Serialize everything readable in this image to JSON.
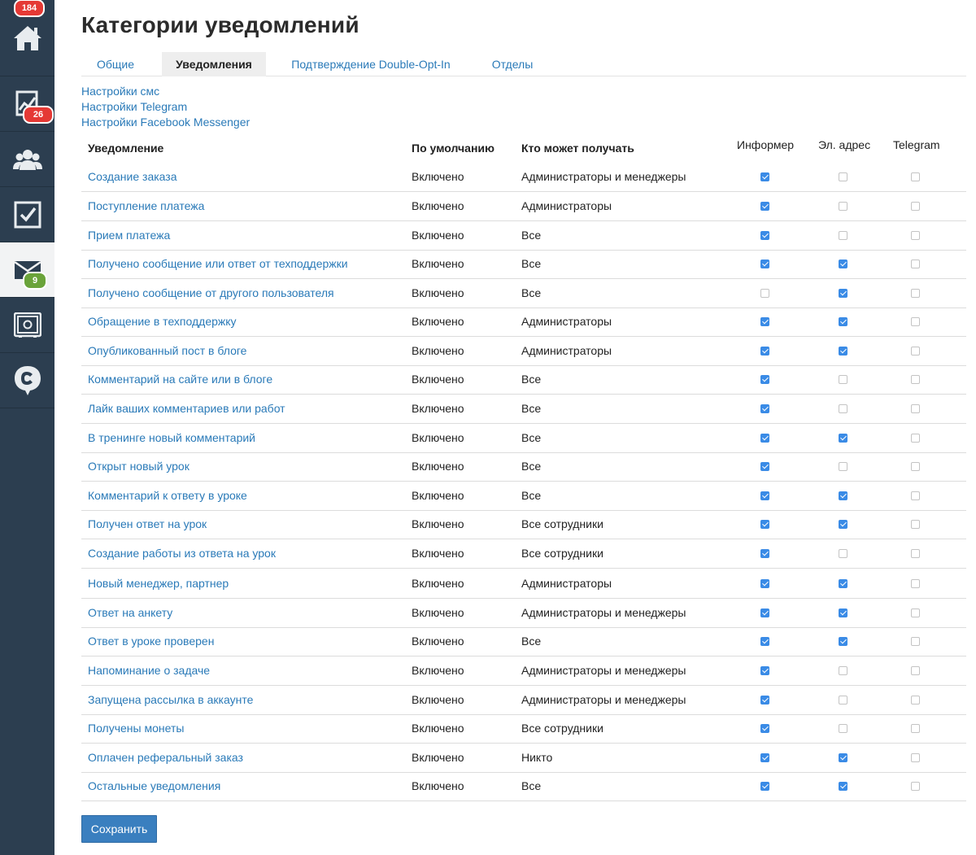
{
  "sidebar": {
    "items": [
      {
        "name": "home",
        "icon": "home-icon",
        "badge": "184",
        "badge_color": "#e53935"
      },
      {
        "name": "stats",
        "icon": "chart-icon",
        "badge": "26",
        "badge_color": "#e53935"
      },
      {
        "name": "users",
        "icon": "users-icon",
        "badge": ""
      },
      {
        "name": "tasks",
        "icon": "checkbox-icon",
        "badge": ""
      },
      {
        "name": "messages",
        "icon": "envelope-icon",
        "badge": "9",
        "badge_color": "#6aa33a"
      },
      {
        "name": "safe",
        "icon": "safe-icon",
        "badge": ""
      },
      {
        "name": "chat",
        "icon": "chat-bubble-icon",
        "badge": ""
      }
    ]
  },
  "page": {
    "title": "Категории уведомлений"
  },
  "tabs": [
    {
      "label": "Общие",
      "active": false
    },
    {
      "label": "Уведомления",
      "active": true
    },
    {
      "label": "Подтверждение Double-Opt-In",
      "active": false
    },
    {
      "label": "Отделы",
      "active": false
    }
  ],
  "links": {
    "sms": "Настройки смс",
    "telegram": "Настройки Telegram",
    "facebook": "Настройки Facebook Messenger"
  },
  "table": {
    "headers": {
      "notification": "Уведомление",
      "default": "По умолчанию",
      "who": "Кто может получать",
      "informer": "Информер",
      "email": "Эл. адрес",
      "telegram": "Telegram"
    },
    "rows": [
      {
        "name": "Создание заказа",
        "default": "Включено",
        "who": "Администраторы и менеджеры",
        "informer": true,
        "email": false,
        "telegram": false
      },
      {
        "name": "Поступление платежа",
        "default": "Включено",
        "who": "Администраторы",
        "informer": true,
        "email": false,
        "telegram": false
      },
      {
        "name": "Прием платежа",
        "default": "Включено",
        "who": "Все",
        "informer": true,
        "email": false,
        "telegram": false
      },
      {
        "name": "Получено сообщение или ответ от техподдержки",
        "default": "Включено",
        "who": "Все",
        "informer": true,
        "email": true,
        "telegram": false
      },
      {
        "name": "Получено сообщение от другого пользователя",
        "default": "Включено",
        "who": "Все",
        "informer": false,
        "email": true,
        "telegram": false
      },
      {
        "name": "Обращение в техподдержку",
        "default": "Включено",
        "who": "Администраторы",
        "informer": true,
        "email": true,
        "telegram": false
      },
      {
        "name": "Опубликованный пост в блоге",
        "default": "Включено",
        "who": "Администраторы",
        "informer": true,
        "email": true,
        "telegram": false
      },
      {
        "name": "Комментарий на сайте или в блоге",
        "default": "Включено",
        "who": "Все",
        "informer": true,
        "email": false,
        "telegram": false
      },
      {
        "name": "Лайк ваших комментариев или работ",
        "default": "Включено",
        "who": "Все",
        "informer": true,
        "email": false,
        "telegram": false
      },
      {
        "name": "В тренинге новый комментарий",
        "default": "Включено",
        "who": "Все",
        "informer": true,
        "email": true,
        "telegram": false
      },
      {
        "name": "Открыт новый урок",
        "default": "Включено",
        "who": "Все",
        "informer": true,
        "email": false,
        "telegram": false
      },
      {
        "name": "Комментарий к ответу в уроке",
        "default": "Включено",
        "who": "Все",
        "informer": true,
        "email": true,
        "telegram": false
      },
      {
        "name": "Получен ответ на урок",
        "default": "Включено",
        "who": "Все сотрудники",
        "informer": true,
        "email": true,
        "telegram": false
      },
      {
        "name": "Создание работы из ответа на урок",
        "default": "Включено",
        "who": "Все сотрудники",
        "informer": true,
        "email": false,
        "telegram": false
      },
      {
        "name": "Новый менеджер, партнер",
        "default": "Включено",
        "who": "Администраторы",
        "informer": true,
        "email": true,
        "telegram": false
      },
      {
        "name": "Ответ на анкету",
        "default": "Включено",
        "who": "Администраторы и менеджеры",
        "informer": true,
        "email": true,
        "telegram": false
      },
      {
        "name": "Ответ в уроке проверен",
        "default": "Включено",
        "who": "Все",
        "informer": true,
        "email": true,
        "telegram": false
      },
      {
        "name": "Напоминание о задаче",
        "default": "Включено",
        "who": "Администраторы и менеджеры",
        "informer": true,
        "email": false,
        "telegram": false
      },
      {
        "name": "Запущена рассылка в аккаунте",
        "default": "Включено",
        "who": "Администраторы и менеджеры",
        "informer": true,
        "email": false,
        "telegram": false
      },
      {
        "name": "Получены монеты",
        "default": "Включено",
        "who": "Все сотрудники",
        "informer": true,
        "email": false,
        "telegram": false
      },
      {
        "name": "Оплачен реферальный заказ",
        "default": "Включено",
        "who": "Никто",
        "informer": true,
        "email": true,
        "telegram": false
      },
      {
        "name": "Остальные уведомления",
        "default": "Включено",
        "who": "Все",
        "informer": true,
        "email": true,
        "telegram": false
      }
    ]
  },
  "buttons": {
    "save": "Сохранить"
  },
  "colors": {
    "sidebar_bg": "#2c3e50",
    "link": "#2a7ab8",
    "checkbox_on": "#3a8be6",
    "save_button": "#3a7fbf"
  }
}
